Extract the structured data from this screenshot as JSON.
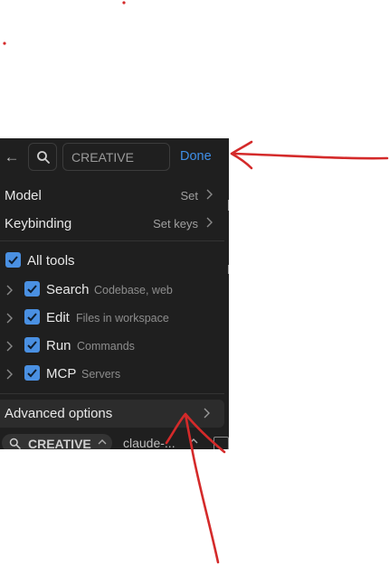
{
  "colors": {
    "panel_bg": "#1f1f1f",
    "accent": "#3f8fe8",
    "checkbox": "#4a90e2",
    "annotation": "#d42a2a"
  },
  "header": {
    "back_icon": "arrow-left-icon",
    "search_icon": "search-icon",
    "name_value": "CREATIVE",
    "done_label": "Done"
  },
  "settings": {
    "model_label": "Model",
    "model_value": "Set",
    "keybinding_label": "Keybinding",
    "keybinding_value": "Set keys"
  },
  "tools": {
    "all_label": "All tools",
    "all_checked": true,
    "items": [
      {
        "name": "Search",
        "desc": "Codebase, web",
        "checked": true
      },
      {
        "name": "Edit",
        "desc": "Files in workspace",
        "checked": true
      },
      {
        "name": "Run",
        "desc": "Commands",
        "checked": true
      },
      {
        "name": "MCP",
        "desc": "Servers",
        "checked": true
      }
    ]
  },
  "advanced": {
    "label": "Advanced options"
  },
  "footer": {
    "mode_name": "CREATIVE",
    "model_name": "claude-..."
  }
}
